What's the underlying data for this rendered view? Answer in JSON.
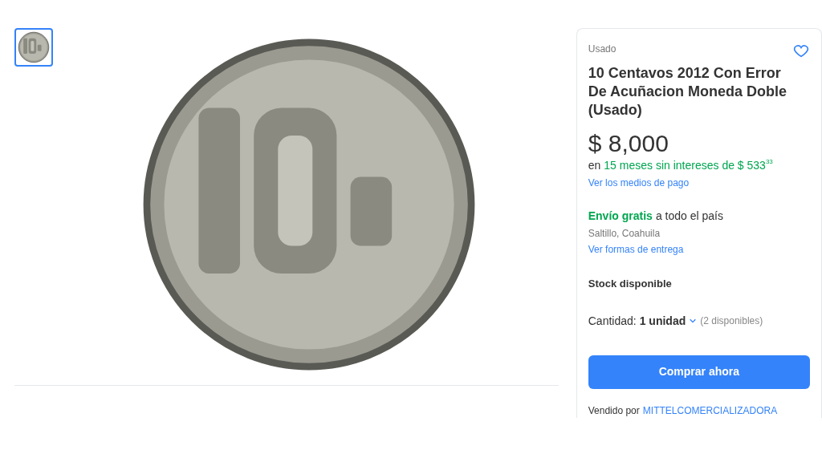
{
  "gallery": {
    "thumbnails": [
      {
        "selected": true
      }
    ]
  },
  "product": {
    "condition": "Usado",
    "favorite": false,
    "title": "10 Centavos 2012 Con Error De Acuñacion Moneda Doble (Usado)",
    "price": "$ 8,000",
    "installments": {
      "prefix": "en",
      "offer": "15 meses sin intereses de $ 533",
      "cents": "33"
    },
    "payment_link": "Ver los medios de pago",
    "shipping": {
      "highlight": "Envío gratis",
      "rest": "a todo el país"
    },
    "location": "Saltillo, Coahuila",
    "delivery_link": "Ver formas de entrega",
    "stock": "Stock disponible",
    "quantity": {
      "label": "Cantidad:",
      "value": "1 unidad",
      "available": "(2 disponibles)"
    },
    "buy_button": "Comprar ahora",
    "seller": {
      "label": "Vendido por",
      "name": "MITTELCOMERCIALIZADORA"
    }
  }
}
